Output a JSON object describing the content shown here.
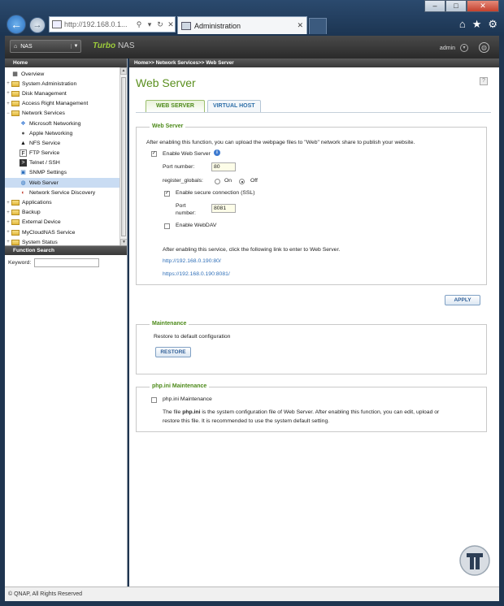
{
  "browser": {
    "url": "http://192.168.0.1...",
    "tab_title": "Administration",
    "window_buttons": [
      "–",
      "□",
      "✕"
    ]
  },
  "topbar": {
    "nas_selector": "NAS",
    "brand_turbo": "Turbo",
    "brand_nas": "NAS",
    "user": "admin"
  },
  "sidebar": {
    "header": "Home",
    "items": [
      {
        "label": "Overview",
        "level": 1
      },
      {
        "label": "System Administration",
        "level": 1
      },
      {
        "label": "Disk Management",
        "level": 1
      },
      {
        "label": "Access Right Management",
        "level": 1
      },
      {
        "label": "Network Services",
        "level": 1
      },
      {
        "label": "Microsoft Networking",
        "level": 2
      },
      {
        "label": "Apple Networking",
        "level": 2
      },
      {
        "label": "NFS Service",
        "level": 2
      },
      {
        "label": "FTP Service",
        "level": 2
      },
      {
        "label": "Telnet / SSH",
        "level": 2
      },
      {
        "label": "SNMP Settings",
        "level": 2
      },
      {
        "label": "Web Server",
        "level": 2
      },
      {
        "label": "Network Service Discovery",
        "level": 2
      },
      {
        "label": "Applications",
        "level": 1
      },
      {
        "label": "Backup",
        "level": 1
      },
      {
        "label": "External Device",
        "level": 1
      },
      {
        "label": "MyCloudNAS Service",
        "level": 1
      },
      {
        "label": "System Status",
        "level": 1
      }
    ],
    "function_search": {
      "header": "Function Search",
      "keyword_label": "Keyword:",
      "keyword_value": ""
    }
  },
  "main": {
    "breadcrumb": "Home>> Network Services>> Web Server",
    "title": "Web Server",
    "tabs": [
      "WEB SERVER",
      "VIRTUAL HOST"
    ],
    "web_server": {
      "legend": "Web Server",
      "description": "After enabling this function, you can upload the webpage files to \"Web\" network share to publish your website.",
      "enable_label": "Enable Web Server",
      "enable_checked": true,
      "port_label": "Port number:",
      "port_value": "80",
      "register_globals_label": "register_globals:",
      "on_label": "On",
      "off_label": "Off",
      "register_globals_value": "Off",
      "ssl_label": "Enable secure connection (SSL)",
      "ssl_checked": true,
      "ssl_port_label_1": "Port",
      "ssl_port_label_2": "number:",
      "ssl_port_value": "8081",
      "webdav_label": "Enable WebDAV",
      "webdav_checked": false,
      "link_intro": "After enabling this service, click the following link to enter to Web Server.",
      "link_http": "http://192.168.0.190:80/",
      "link_https": "https://192.168.0.190:8081/"
    },
    "apply_label": "APPLY",
    "maintenance": {
      "legend": "Maintenance",
      "text": "Restore to default configuration",
      "restore_label": "RESTORE"
    },
    "phpini": {
      "legend": "php.ini Maintenance",
      "checkbox_label": "php.ini Maintenance",
      "checked": false,
      "desc_pre": "The file ",
      "desc_bold": "php.ini",
      "desc_line1": " is the system configuration file of Web Server. After enabling this function, you can edit, upload or",
      "desc_line2": "restore this file. It is recommended to use the system default setting."
    }
  },
  "footer": {
    "copyright": "© QNAP, All Rights Reserved"
  },
  "colors": {
    "accent_green": "#5a8f1e",
    "link_blue": "#2f6fb8",
    "header_dark": "#383838"
  }
}
